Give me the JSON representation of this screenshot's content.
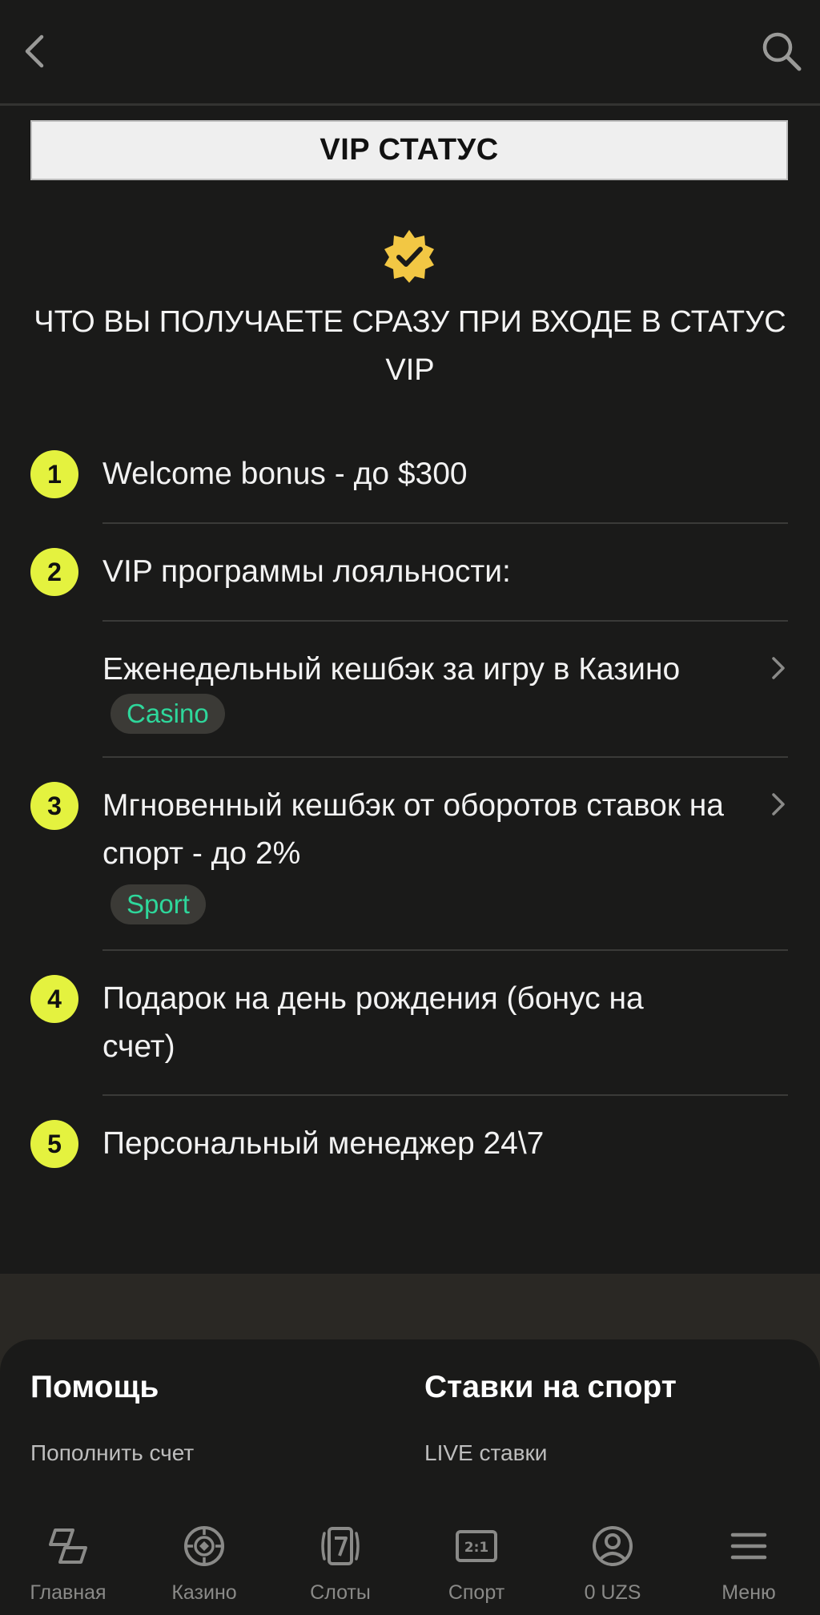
{
  "header": {
    "back_icon": "chevron-left-icon",
    "search_icon": "search-icon"
  },
  "title": "VIP СТАТУС",
  "headline": "ЧТО ВЫ ПОЛУЧАЕТЕ СРАЗУ ПРИ ВХОДЕ В СТАТУС VIP",
  "list": [
    {
      "num": "1",
      "text": "Welcome bonus - до $300"
    },
    {
      "num": "2",
      "text": "VIP программы лояльности:"
    },
    {
      "num": "",
      "text": "Еженедельный кешбэк за игру в Казино",
      "tag": "Casino"
    },
    {
      "num": "3",
      "text": "Мгновенный кешбэк от оборотов ставок на спорт - до 2%",
      "tag": "Sport"
    },
    {
      "num": "4",
      "text": "Подарок на день рождения (бонус на счет)"
    },
    {
      "num": "5",
      "text": "Персональный менеджер 24\\7"
    }
  ],
  "footer": {
    "col1_title": "Помощь",
    "col1_link": "Пополнить счет",
    "col2_title": "Ставки на спорт",
    "col2_link": "LIVE ставки"
  },
  "nav": [
    {
      "label": "Главная",
      "icon": "home-icon"
    },
    {
      "label": "Казино",
      "icon": "casino-chip-icon"
    },
    {
      "label": "Слоты",
      "icon": "slots-icon"
    },
    {
      "label": "Спорт",
      "icon": "sport-icon"
    },
    {
      "label": "0 UZS",
      "icon": "account-icon"
    },
    {
      "label": "Меню",
      "icon": "menu-icon"
    }
  ],
  "colors": {
    "background": "#1a1a19",
    "accent_yellow": "#e4f23f",
    "tag_green": "#2ed79b",
    "badge_gold": "#f2c744"
  }
}
